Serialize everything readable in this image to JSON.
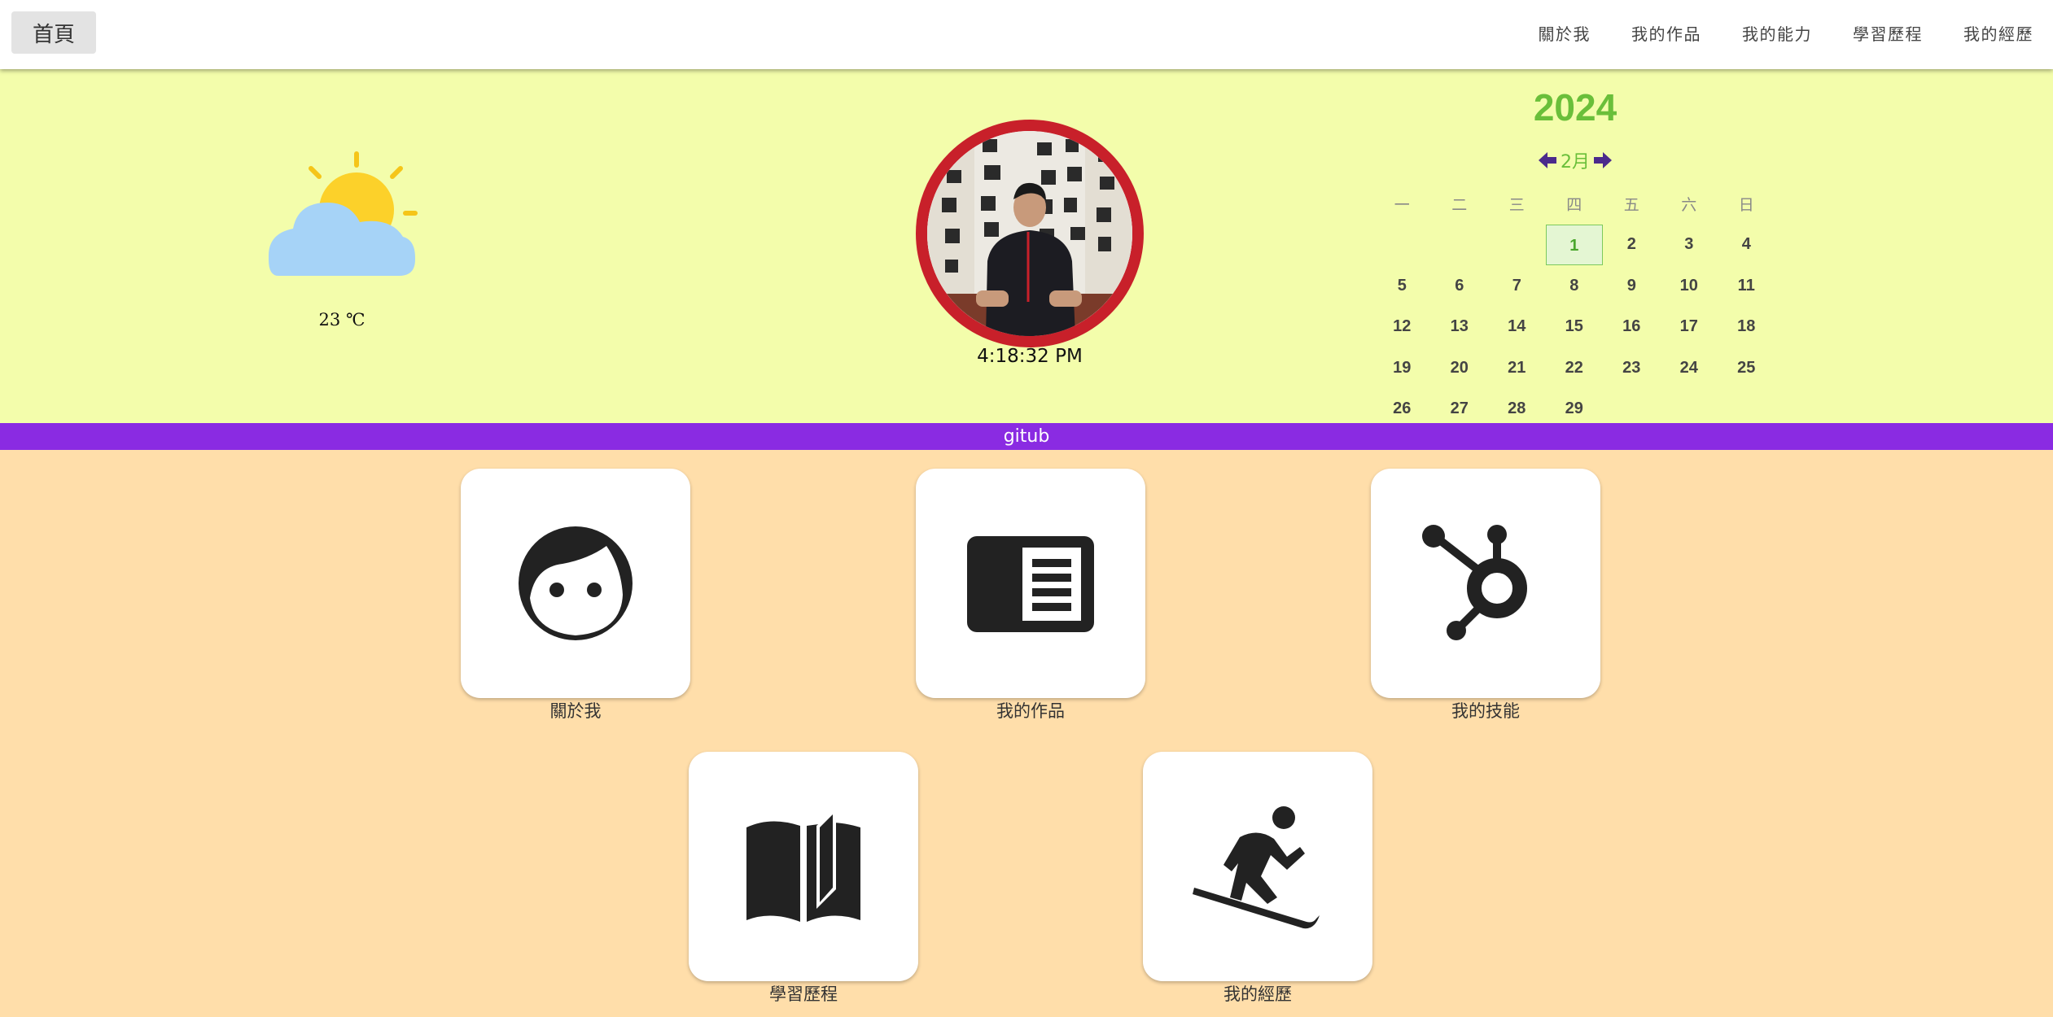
{
  "nav": {
    "home_label": "首頁",
    "links": [
      "關於我",
      "我的作品",
      "我的能力",
      "學習歷程",
      "我的經歷"
    ]
  },
  "weather": {
    "icon": "partly-cloudy-icon",
    "temperature": "23 ℃"
  },
  "profile": {
    "clock": "4:18:32 PM"
  },
  "calendar": {
    "year": "2024",
    "month": "2月",
    "weekdays": [
      "一",
      "二",
      "三",
      "四",
      "五",
      "六",
      "日"
    ],
    "today": "1",
    "weeks": [
      [
        "",
        "",
        "",
        "1",
        "2",
        "3",
        "4"
      ],
      [
        "5",
        "6",
        "7",
        "8",
        "9",
        "10",
        "11"
      ],
      [
        "12",
        "13",
        "14",
        "15",
        "16",
        "17",
        "18"
      ],
      [
        "19",
        "20",
        "21",
        "22",
        "23",
        "24",
        "25"
      ],
      [
        "26",
        "27",
        "28",
        "29",
        "",
        "",
        ""
      ]
    ],
    "colors": {
      "accent": "#6abf3a",
      "arrow": "#4b2a8c"
    }
  },
  "github_bar": {
    "label": "gitub",
    "color": "#8a2be2"
  },
  "cards": [
    {
      "label": "關於我",
      "icon": "face-icon"
    },
    {
      "label": "我的作品",
      "icon": "article-icon"
    },
    {
      "label": "我的技能",
      "icon": "hubspot-icon"
    },
    {
      "label": "學習歷程",
      "icon": "book-icon"
    },
    {
      "label": "我的經歷",
      "icon": "snowboarding-icon"
    }
  ],
  "colors": {
    "hero_bg": "#f3fdab",
    "page_bg": "#ffdeaa",
    "avatar_ring": "#c8202a"
  }
}
